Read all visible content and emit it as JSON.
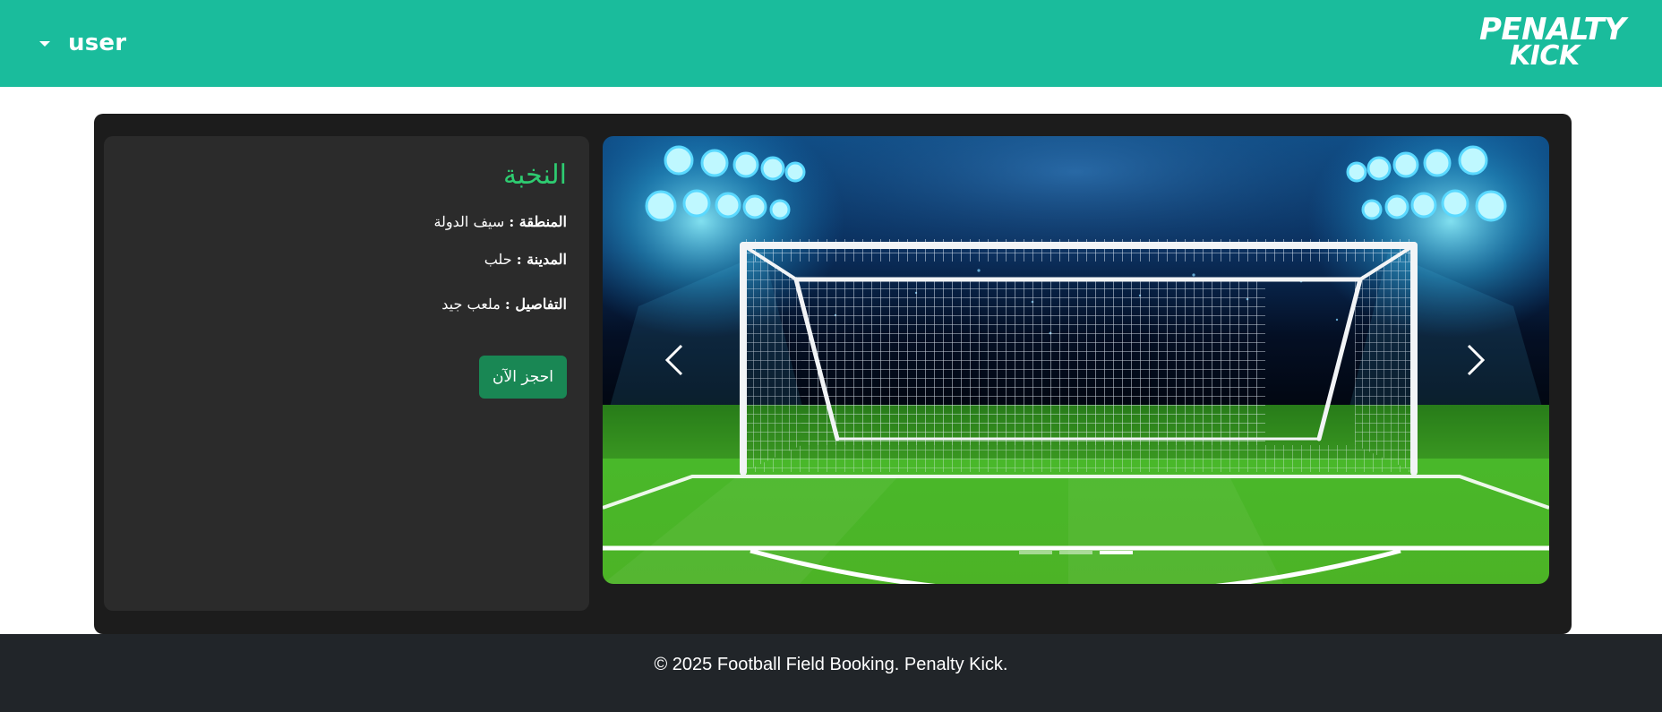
{
  "header": {
    "user_label": "user",
    "logo_line1": "PENALTY",
    "logo_line2": "KICK",
    "bg_color": "#1abc9c"
  },
  "field": {
    "name": "النخبة",
    "region_label": "المنطقة :",
    "region_value": "سيف الدولة",
    "city_label": "المدينة :",
    "city_value": "حلب",
    "details_label": "التفاصيل :",
    "details_value": "ملعب جيد",
    "book_button": "احجز الآن",
    "name_color": "#2ecc71",
    "button_color": "#198754"
  },
  "carousel": {
    "slide_count": 3,
    "active_index": 2,
    "prev_icon": "chevron-left-icon",
    "next_icon": "chevron-right-icon"
  },
  "footer": {
    "text": "© 2025 Football Field Booking. Penalty Kick."
  }
}
